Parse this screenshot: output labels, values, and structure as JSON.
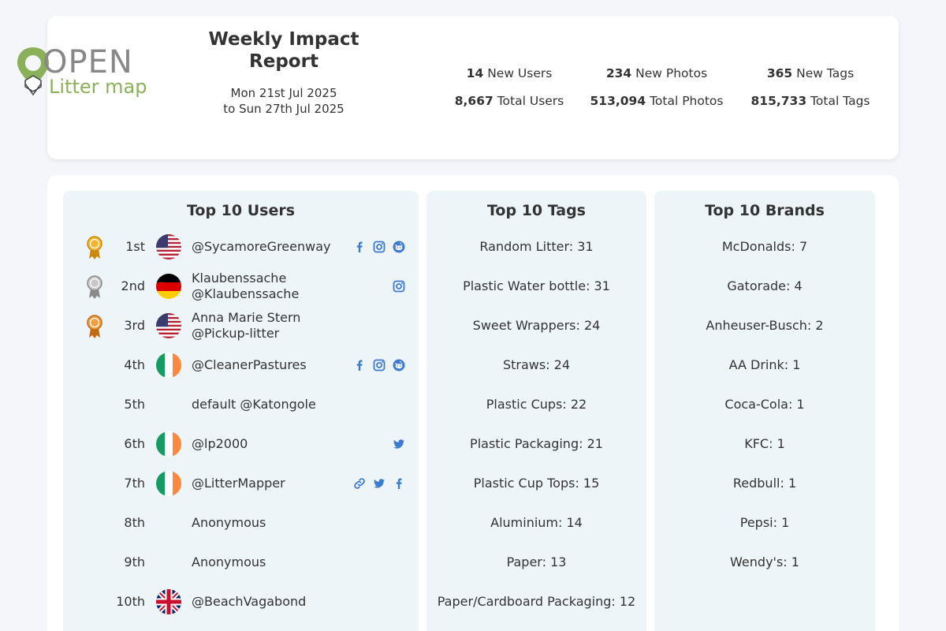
{
  "header": {
    "logo_open": "OPEN",
    "logo_litter_map": "Litter map",
    "title": "Weekly Impact Report",
    "date_from": "Mon 21st Jul 2025",
    "date_to": "to Sun 27th Jul 2025",
    "stats": {
      "new_users_value": "14",
      "new_users_label": "New Users",
      "new_photos_value": "234",
      "new_photos_label": "New Photos",
      "new_tags_value": "365",
      "new_tags_label": "New Tags",
      "total_users_value": "8,667",
      "total_users_label": "Total Users",
      "total_photos_value": "513,094",
      "total_photos_label": "Total Photos",
      "total_tags_value": "815,733",
      "total_tags_label": "Total Tags"
    }
  },
  "users": {
    "title": "Top 10 Users",
    "rows": [
      {
        "rank": "1st",
        "line1": "@SycamoreGreenway",
        "line2": "",
        "flag": "us",
        "medal": "gold",
        "socials": [
          "facebook-icon",
          "instagram-icon",
          "reddit-icon"
        ]
      },
      {
        "rank": "2nd",
        "line1": "Klaubenssache",
        "line2": "@Klaubenssache",
        "flag": "de",
        "medal": "silver",
        "socials": [
          "instagram-icon"
        ]
      },
      {
        "rank": "3rd",
        "line1": "Anna Marie Stern",
        "line2": "@Pickup-litter",
        "flag": "us",
        "medal": "bronze",
        "socials": []
      },
      {
        "rank": "4th",
        "line1": "@CleanerPastures",
        "line2": "",
        "flag": "ie",
        "medal": "",
        "socials": [
          "facebook-icon",
          "instagram-icon",
          "reddit-icon"
        ]
      },
      {
        "rank": "5th",
        "line1": "default @Katongole",
        "line2": "",
        "flag": "",
        "medal": "",
        "socials": []
      },
      {
        "rank": "6th",
        "line1": "@lp2000",
        "line2": "",
        "flag": "ie",
        "medal": "",
        "socials": [
          "twitter-icon"
        ]
      },
      {
        "rank": "7th",
        "line1": "@LitterMapper",
        "line2": "",
        "flag": "ie",
        "medal": "",
        "socials": [
          "link-icon",
          "twitter-icon",
          "facebook-icon"
        ]
      },
      {
        "rank": "8th",
        "line1": "Anonymous",
        "line2": "",
        "flag": "",
        "medal": "",
        "socials": []
      },
      {
        "rank": "9th",
        "line1": "Anonymous",
        "line2": "",
        "flag": "",
        "medal": "",
        "socials": []
      },
      {
        "rank": "10th",
        "line1": "@BeachVagabond",
        "line2": "",
        "flag": "gb",
        "medal": "",
        "socials": []
      }
    ]
  },
  "tags": {
    "title": "Top 10 Tags",
    "items": [
      "Random Litter: 31",
      "Plastic Water bottle: 31",
      "Sweet Wrappers: 24",
      "Straws: 24",
      "Plastic Cups: 22",
      "Plastic Packaging: 21",
      "Plastic Cup Tops: 15",
      "Aluminium: 14",
      "Paper: 13",
      "Paper/Cardboard Packaging: 12"
    ]
  },
  "brands": {
    "title": "Top 10 Brands",
    "items": [
      "McDonalds: 7",
      "Gatorade: 4",
      "Anheuser-Busch: 2",
      "AA Drink: 1",
      "Coca-Cola: 1",
      "KFC: 1",
      "Redbull: 1",
      "Pepsi: 1",
      "Wendy's: 1"
    ]
  },
  "colors": {
    "panel_bg": "#eef5f8",
    "social_blue": "#3d7bd0",
    "logo_green": "#8bb05a",
    "logo_grey": "#888888"
  }
}
